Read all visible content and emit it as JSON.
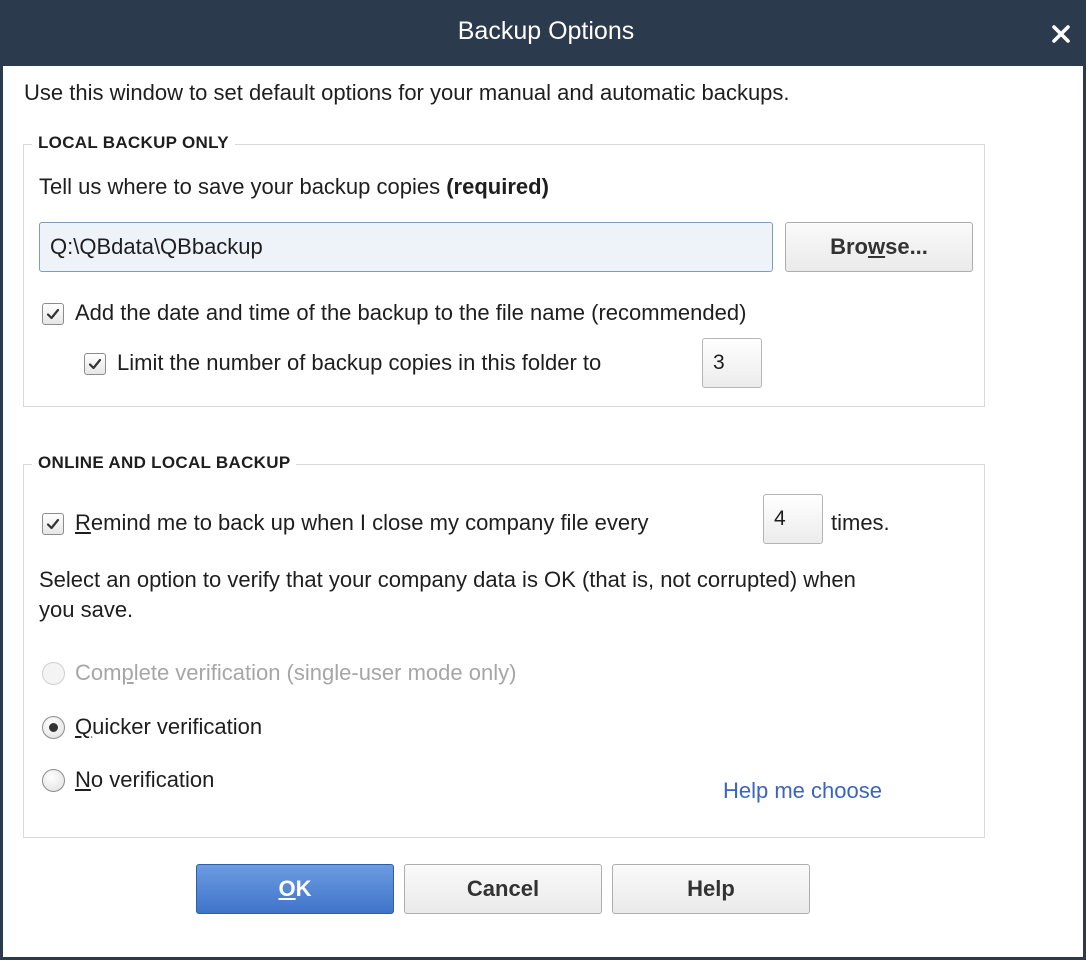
{
  "window": {
    "title": "Backup Options",
    "intro": "Use this window to set default options for your manual and automatic backups."
  },
  "local_backup": {
    "group_label": "LOCAL BACKUP ONLY",
    "prompt": "Tell us where to save your backup copies ",
    "prompt_required": "(required)",
    "path_value": "Q:\\QBdata\\QBbackup",
    "browse": {
      "pre": "Bro",
      "accel": "w",
      "post": "se..."
    },
    "add_date_label": "Add the date and time of the backup to the file name (recommended)",
    "add_date_checked": true,
    "limit_label": "Limit the number of backup copies in this folder to",
    "limit_checked": true,
    "limit_value": "3"
  },
  "online_backup": {
    "group_label": "ONLINE AND LOCAL BACKUP",
    "remind": {
      "accel": "R",
      "rest": "emind me to back up when I close my company file every"
    },
    "remind_checked": true,
    "remind_value": "4",
    "remind_suffix": "times.",
    "verify_line1": "Select an option to verify that your company data is OK (that is, not corrupted) when",
    "verify_line2": "you save.",
    "options": [
      {
        "pre": "Com",
        "accel": "p",
        "post": "lete verification (single-user mode only)",
        "selected": false,
        "disabled": true
      },
      {
        "pre": "",
        "accel": "Q",
        "post": "uicker verification",
        "selected": true,
        "disabled": false
      },
      {
        "pre": "",
        "accel": "N",
        "post": "o verification",
        "selected": false,
        "disabled": false
      }
    ],
    "help_link": "Help me choose"
  },
  "buttons": {
    "ok": {
      "accel": "O",
      "rest": "K"
    },
    "cancel": "Cancel",
    "help": "Help"
  },
  "icons": {
    "close": "close-icon",
    "check": "checkmark-icon",
    "radio_dot": "radio-dot-icon"
  },
  "colors": {
    "titlebar": "#2b3a4c",
    "primary_button": "#4a7fd4",
    "link": "#3a64c0",
    "input_bg": "#eef3fa"
  }
}
